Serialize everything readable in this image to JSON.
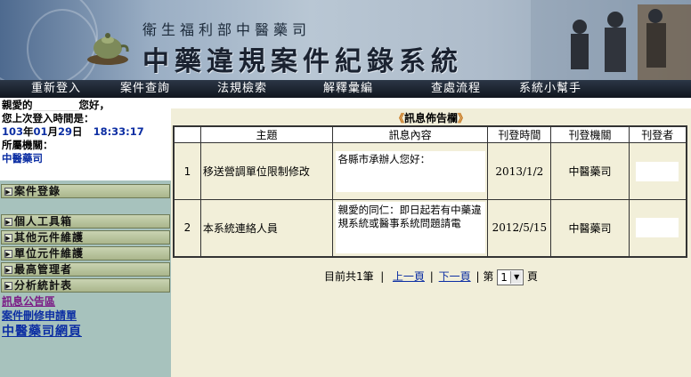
{
  "header": {
    "org": "衛生福利部中醫藥司",
    "title": "中藥違規案件紀錄系統"
  },
  "nav": [
    {
      "label": "重新登入"
    },
    {
      "label": "案件查詢"
    },
    {
      "label": "法規檢索"
    },
    {
      "label": "解釋彙編"
    },
    {
      "label": "查處流程"
    },
    {
      "label": "系統小幫手"
    }
  ],
  "sidebar": {
    "greeting_prefix": "親愛的",
    "greeting_suffix": "您好，",
    "last_login_label": "您上次登入時間是：",
    "last_login": {
      "year": "103",
      "year_unit": "年",
      "month": "01",
      "month_unit": "月",
      "day": "29",
      "day_unit": "日",
      "time": "18:33:17"
    },
    "dept_label": "所屬機關：",
    "dept": "中醫藥司",
    "menu": [
      {
        "label": "案件登錄"
      },
      {
        "label": "個人工具箱"
      },
      {
        "label": "其他元件維護"
      },
      {
        "label": "單位元件維護"
      },
      {
        "label": "最高管理者"
      },
      {
        "label": "分析統計表"
      }
    ],
    "links": [
      {
        "label": "訊息公告區"
      },
      {
        "label": "案件刪修申請單"
      },
      {
        "label": "中醫藥司網頁"
      }
    ]
  },
  "bulletin": {
    "title_deco_left": "《",
    "title": "訊息佈告欄",
    "title_deco_right": "》",
    "columns": [
      "主題",
      "訊息內容",
      "刊登時間",
      "刊登機關",
      "刊登者"
    ],
    "rows": [
      {
        "no": "1",
        "subject": "移送營調單位限制修改",
        "content": "各縣市承辦人您好：",
        "date": "2013/1/2",
        "agency": "中醫藥司",
        "publisher": ""
      },
      {
        "no": "2",
        "subject": "本系統連絡人員",
        "content": "親愛的同仁：即日起若有中藥違規系統或醫事系統問題請電",
        "date": "2012/5/15",
        "agency": "中醫藥司",
        "publisher": ""
      }
    ]
  },
  "pager": {
    "summary": "目前共1筆",
    "sep": "|",
    "prev": "上一頁",
    "next": "下一頁",
    "page_prefix": "第",
    "page_value": "1",
    "page_suffix": "頁"
  },
  "colors": {
    "nav_bg": "#1b2330",
    "sidebar_bg": "#a7c2bd",
    "main_bg": "#f1eed9",
    "link_blue": "#0c2ea3",
    "deco_orange": "#c46b0a"
  }
}
